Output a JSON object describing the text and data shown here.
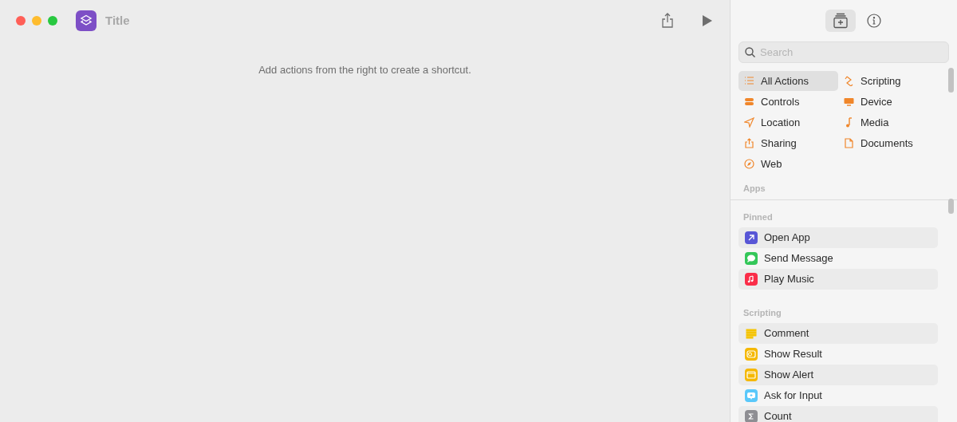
{
  "window": {
    "title": "Title"
  },
  "editor": {
    "hint": "Add actions from the right to create a shortcut."
  },
  "panel_tabs": [
    {
      "kind": "library",
      "selected": true
    },
    {
      "kind": "info",
      "selected": false
    }
  ],
  "search": {
    "placeholder": "Search"
  },
  "categories": [
    {
      "label": "All Actions",
      "selected": true
    },
    {
      "label": "Scripting",
      "selected": false
    },
    {
      "label": "Controls",
      "selected": false
    },
    {
      "label": "Device",
      "selected": false
    },
    {
      "label": "Location",
      "selected": false
    },
    {
      "label": "Media",
      "selected": false
    },
    {
      "label": "Sharing",
      "selected": false
    },
    {
      "label": "Documents",
      "selected": false
    },
    {
      "label": "Web",
      "selected": false
    }
  ],
  "apps_heading": "Apps",
  "sections": [
    {
      "heading": "Pinned",
      "actions": [
        {
          "label": "Open App",
          "color": "#5856d6"
        },
        {
          "label": "Send Message",
          "color": "#34c759"
        },
        {
          "label": "Play Music",
          "color": "#fa2d48"
        }
      ]
    },
    {
      "heading": "Scripting",
      "actions": [
        {
          "label": "Comment",
          "color": "#f5c400"
        },
        {
          "label": "Show Result",
          "color": "#f5b800"
        },
        {
          "label": "Show Alert",
          "color": "#f5b800"
        },
        {
          "label": "Ask for Input",
          "color": "#5ac8fa"
        },
        {
          "label": "Count",
          "color": "#8e8e93"
        }
      ]
    }
  ]
}
